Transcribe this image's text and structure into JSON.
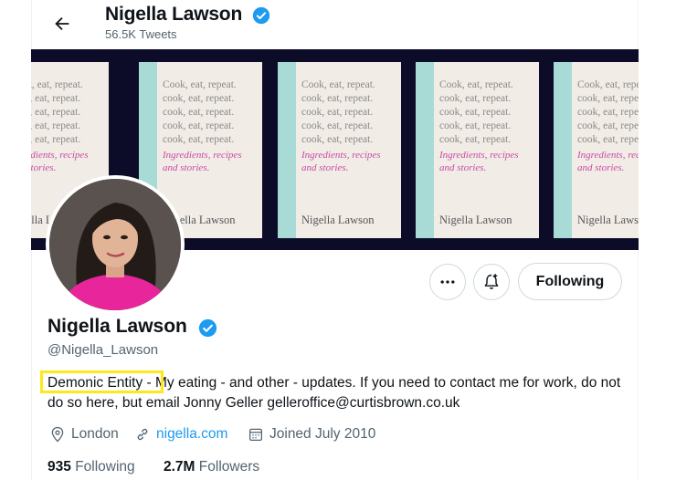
{
  "header": {
    "name": "Nigella Lawson",
    "tweet_count": "56.5K Tweets"
  },
  "banner": {
    "book_lines": "Cook, eat, repeat.\ncook, eat, repeat.\ncook, eat, repeat.\ncook, eat, repeat.\ncook, eat, repeat.",
    "book_subtitle": "Ingredients, recipes\nand stories.",
    "book_author": "Nigella Lawson"
  },
  "profile": {
    "name": "Nigella Lawson",
    "handle": "@Nigella_Lawson",
    "bio_highlight": "Demonic Entity",
    "bio_rest": " - My eating - and other - updates. If you need to contact me for work, do not do so here, but email Jonny Geller gelleroffice@curtisbrown.co.uk",
    "location": "London",
    "website": "nigella.com",
    "joined": "Joined July 2010",
    "following_count": "935",
    "following_label": "Following",
    "followers_count": "2.7M",
    "followers_label": "Followers"
  },
  "actions": {
    "follow_label": "Following"
  },
  "colors": {
    "accent": "#1d9bf0",
    "verified": "#1d9bf0",
    "highlight": "#ffe81a"
  }
}
